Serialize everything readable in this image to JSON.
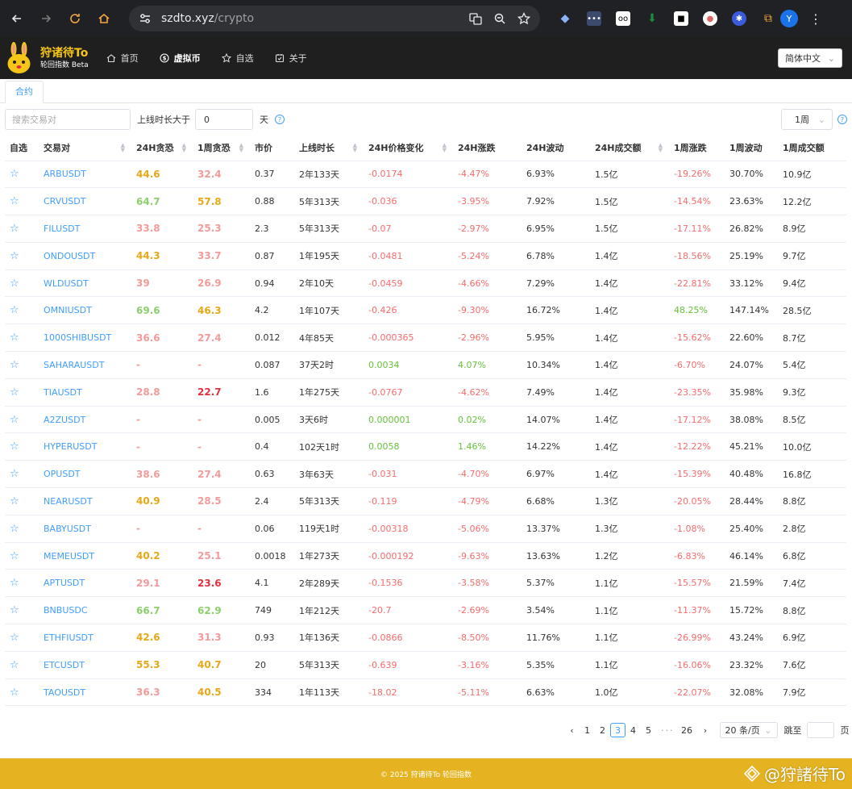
{
  "browser": {
    "url_host": "szdto.xyz",
    "url_path": "/crypto",
    "profile_initial": "Y"
  },
  "site": {
    "title": "狩诸待To",
    "subtitle": "轮回指数 Beta",
    "menu": [
      {
        "label": "首页",
        "icon": "home-icon"
      },
      {
        "label": "虚拟币",
        "icon": "coin-icon"
      },
      {
        "label": "自选",
        "icon": "star-icon"
      },
      {
        "label": "关于",
        "icon": "calendar-icon"
      }
    ],
    "language": "简体中文"
  },
  "tabs": [
    {
      "label": "合约"
    }
  ],
  "filters": {
    "search_placeholder": "搜索交易对",
    "online_label": "上线时长大于",
    "online_value": "0",
    "online_unit": "天",
    "period": "1周"
  },
  "table": {
    "columns": [
      "自选",
      "交易对",
      "24H贪恐",
      "1周贪恐",
      "市价",
      "上线时长",
      "24H价格变化",
      "24H涨跌",
      "24H波动",
      "24H成交额",
      "1周涨跌",
      "1周波动",
      "1周成交额"
    ],
    "rows": [
      {
        "pair": "ARBUSDT",
        "fear24": "44.6",
        "fear1w": "32.4",
        "price": "0.37",
        "online": "2年133天",
        "chg": "-0.0174",
        "pct24": "-4.47%",
        "vol24": "6.93%",
        "amt24": "1.5亿",
        "pct1w": "-19.26%",
        "vol1w": "30.70%",
        "amt1w": "10.9亿"
      },
      {
        "pair": "CRVUSDT",
        "fear24": "64.7",
        "fear1w": "57.8",
        "price": "0.88",
        "online": "5年313天",
        "chg": "-0.036",
        "pct24": "-3.95%",
        "vol24": "7.92%",
        "amt24": "1.5亿",
        "pct1w": "-14.54%",
        "vol1w": "23.63%",
        "amt1w": "12.2亿"
      },
      {
        "pair": "FILUSDT",
        "fear24": "33.8",
        "fear1w": "25.3",
        "price": "2.3",
        "online": "5年313天",
        "chg": "-0.07",
        "pct24": "-2.97%",
        "vol24": "6.95%",
        "amt24": "1.5亿",
        "pct1w": "-17.11%",
        "vol1w": "26.82%",
        "amt1w": "8.9亿"
      },
      {
        "pair": "ONDOUSDT",
        "fear24": "44.3",
        "fear1w": "33.7",
        "price": "0.87",
        "online": "1年195天",
        "chg": "-0.0481",
        "pct24": "-5.24%",
        "vol24": "6.78%",
        "amt24": "1.4亿",
        "pct1w": "-18.56%",
        "vol1w": "25.19%",
        "amt1w": "9.7亿"
      },
      {
        "pair": "WLDUSDT",
        "fear24": "39",
        "fear1w": "26.9",
        "price": "0.94",
        "online": "2年10天",
        "chg": "-0.0459",
        "pct24": "-4.66%",
        "vol24": "7.29%",
        "amt24": "1.4亿",
        "pct1w": "-22.81%",
        "vol1w": "33.12%",
        "amt1w": "9.4亿"
      },
      {
        "pair": "OMNIUSDT",
        "fear24": "69.6",
        "fear1w": "46.3",
        "price": "4.2",
        "online": "1年107天",
        "chg": "-0.426",
        "pct24": "-9.30%",
        "vol24": "16.72%",
        "amt24": "1.4亿",
        "pct1w": "48.25%",
        "vol1w": "147.14%",
        "amt1w": "28.5亿"
      },
      {
        "pair": "1000SHIBUSDT",
        "fear24": "36.6",
        "fear1w": "27.4",
        "price": "0.012",
        "online": "4年85天",
        "chg": "-0.000365",
        "pct24": "-2.96%",
        "vol24": "5.95%",
        "amt24": "1.4亿",
        "pct1w": "-15.62%",
        "vol1w": "22.60%",
        "amt1w": "8.7亿"
      },
      {
        "pair": "SAHARAUSDT",
        "fear24": "-",
        "fear1w": "-",
        "price": "0.087",
        "online": "37天2时",
        "chg": "0.0034",
        "pct24": "4.07%",
        "vol24": "10.34%",
        "amt24": "1.4亿",
        "pct1w": "-6.70%",
        "vol1w": "24.07%",
        "amt1w": "5.4亿"
      },
      {
        "pair": "TIAUSDT",
        "fear24": "28.8",
        "fear1w": "22.7",
        "price": "1.6",
        "online": "1年275天",
        "chg": "-0.0767",
        "pct24": "-4.62%",
        "vol24": "7.49%",
        "amt24": "1.4亿",
        "pct1w": "-23.35%",
        "vol1w": "35.98%",
        "amt1w": "9.3亿"
      },
      {
        "pair": "A2ZUSDT",
        "fear24": "-",
        "fear1w": "-",
        "price": "0.005",
        "online": "3天6时",
        "chg": "0.000001",
        "pct24": "0.02%",
        "vol24": "14.07%",
        "amt24": "1.4亿",
        "pct1w": "-17.12%",
        "vol1w": "38.08%",
        "amt1w": "8.5亿"
      },
      {
        "pair": "HYPERUSDT",
        "fear24": "-",
        "fear1w": "-",
        "price": "0.4",
        "online": "102天1时",
        "chg": "0.0058",
        "pct24": "1.46%",
        "vol24": "14.22%",
        "amt24": "1.4亿",
        "pct1w": "-12.22%",
        "vol1w": "45.21%",
        "amt1w": "10.0亿"
      },
      {
        "pair": "OPUSDT",
        "fear24": "38.6",
        "fear1w": "27.4",
        "price": "0.63",
        "online": "3年63天",
        "chg": "-0.031",
        "pct24": "-4.70%",
        "vol24": "6.97%",
        "amt24": "1.4亿",
        "pct1w": "-15.39%",
        "vol1w": "40.48%",
        "amt1w": "16.8亿"
      },
      {
        "pair": "NEARUSDT",
        "fear24": "40.9",
        "fear1w": "28.5",
        "price": "2.4",
        "online": "5年313天",
        "chg": "-0.119",
        "pct24": "-4.79%",
        "vol24": "6.68%",
        "amt24": "1.3亿",
        "pct1w": "-20.05%",
        "vol1w": "28.44%",
        "amt1w": "8.8亿"
      },
      {
        "pair": "BABYUSDT",
        "fear24": "-",
        "fear1w": "-",
        "price": "0.06",
        "online": "119天1时",
        "chg": "-0.00318",
        "pct24": "-5.06%",
        "vol24": "13.37%",
        "amt24": "1.3亿",
        "pct1w": "-1.08%",
        "vol1w": "25.40%",
        "amt1w": "2.8亿"
      },
      {
        "pair": "MEMEUSDT",
        "fear24": "40.2",
        "fear1w": "25.1",
        "price": "0.0018",
        "online": "1年273天",
        "chg": "-0.000192",
        "pct24": "-9.63%",
        "vol24": "13.63%",
        "amt24": "1.2亿",
        "pct1w": "-6.83%",
        "vol1w": "46.14%",
        "amt1w": "6.8亿"
      },
      {
        "pair": "APTUSDT",
        "fear24": "29.1",
        "fear1w": "23.6",
        "price": "4.1",
        "online": "2年289天",
        "chg": "-0.1536",
        "pct24": "-3.58%",
        "vol24": "5.37%",
        "amt24": "1.1亿",
        "pct1w": "-15.57%",
        "vol1w": "21.59%",
        "amt1w": "7.4亿"
      },
      {
        "pair": "BNBUSDC",
        "fear24": "66.7",
        "fear1w": "62.9",
        "price": "749",
        "online": "1年212天",
        "chg": "-20.7",
        "pct24": "-2.69%",
        "vol24": "3.54%",
        "amt24": "1.1亿",
        "pct1w": "-11.37%",
        "vol1w": "15.72%",
        "amt1w": "8.8亿"
      },
      {
        "pair": "ETHFIUSDT",
        "fear24": "42.6",
        "fear1w": "31.3",
        "price": "0.93",
        "online": "1年136天",
        "chg": "-0.0866",
        "pct24": "-8.50%",
        "vol24": "11.76%",
        "amt24": "1.1亿",
        "pct1w": "-26.99%",
        "vol1w": "43.24%",
        "amt1w": "6.9亿"
      },
      {
        "pair": "ETCUSDT",
        "fear24": "55.3",
        "fear1w": "40.7",
        "price": "20",
        "online": "5年313天",
        "chg": "-0.639",
        "pct24": "-3.16%",
        "vol24": "5.35%",
        "amt24": "1.1亿",
        "pct1w": "-16.06%",
        "vol1w": "23.32%",
        "amt1w": "7.6亿"
      },
      {
        "pair": "TAOUSDT",
        "fear24": "36.3",
        "fear1w": "40.5",
        "price": "334",
        "online": "1年113天",
        "chg": "-18.02",
        "pct24": "-5.11%",
        "vol24": "6.63%",
        "amt24": "1.0亿",
        "pct1w": "-22.07%",
        "vol1w": "32.08%",
        "amt1w": "7.9亿"
      }
    ]
  },
  "pagination": {
    "pages": [
      "1",
      "2",
      "3",
      "4",
      "5"
    ],
    "current": "3",
    "ellipsis": "···",
    "last": "26",
    "page_size": "20 条/页",
    "goto_label": "跳至",
    "goto_unit": "页"
  },
  "footer": {
    "copyright": "© 2025 狩诸待To 轮回指数",
    "watermark": "@狩諸待To"
  },
  "colors": {
    "accent": "#409eff",
    "red": "#f56c6c",
    "green": "#67c23a",
    "fear_green": "#8cd06e",
    "fear_yellow": "#e6a817",
    "fear_pink": "#f29b9b",
    "fear_red": "#e0303e",
    "footer": "#e5b321"
  }
}
